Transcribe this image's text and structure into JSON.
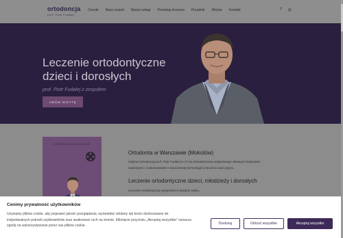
{
  "logo": {
    "title": "ortodoncja",
    "subtitle": "prof. Piotr Fudalej"
  },
  "nav": {
    "items": [
      "Cennik",
      "Nasz zespół",
      "Nasze usługi",
      "Przebieg leczenia",
      "Poradnik",
      "Wizyta",
      "Kontakt"
    ]
  },
  "social": {
    "facebook": "f",
    "instagram": "◎"
  },
  "hero": {
    "title_line1": "Leczenie ortodontyczne",
    "title_line2": "dzieci i dorosłych",
    "subtitle": "prof. Piotr Fudalej z zespołem",
    "button": "UMÓW WIZYTĘ"
  },
  "book": {
    "title": "ORTODONCJA DLA LUDZI"
  },
  "section1": {
    "heading": "Ortodonta w Warszawie (Mokotów)",
    "text_line1": "Gabinet Ortodoncja prof. Piotr Fudalej to 27 lat doświadczenia wspieranego własnymi badaniami",
    "text_line2": "naukowymi i zastosowaniem nowoczesnej technologii w leczeniu wad zgryzu."
  },
  "section2": {
    "heading": "Leczenie ortodontyczne dzieci, młodzieży i dorosłych",
    "text_line1": "Leczenie ortodontyczne pacjentów w każdym wieku."
  },
  "cookie": {
    "title": "Cenimy prywatność użytkowników",
    "text_line1": "Używamy plików cookie, aby poprawić jakość przeglądania, wyświetlać reklamy lub treści dostosowane do",
    "text_line2": "indywidualnych potrzeb użytkowników oraz analizować ruch na stronie. Kliknięcie przycisku „Akceptuj wszystkie” oznacza",
    "text_line3": "zgodę na wykorzystywanie przez nas plików cookie.",
    "settings_label": "Dostosuj",
    "reject_label": "Odrzuć wszystkie",
    "accept_label": "Akceptuj wszystko"
  },
  "colors": {
    "hero_bg": "#2a1f3f",
    "accent": "#3d2a58",
    "button": "#6e4a70"
  }
}
